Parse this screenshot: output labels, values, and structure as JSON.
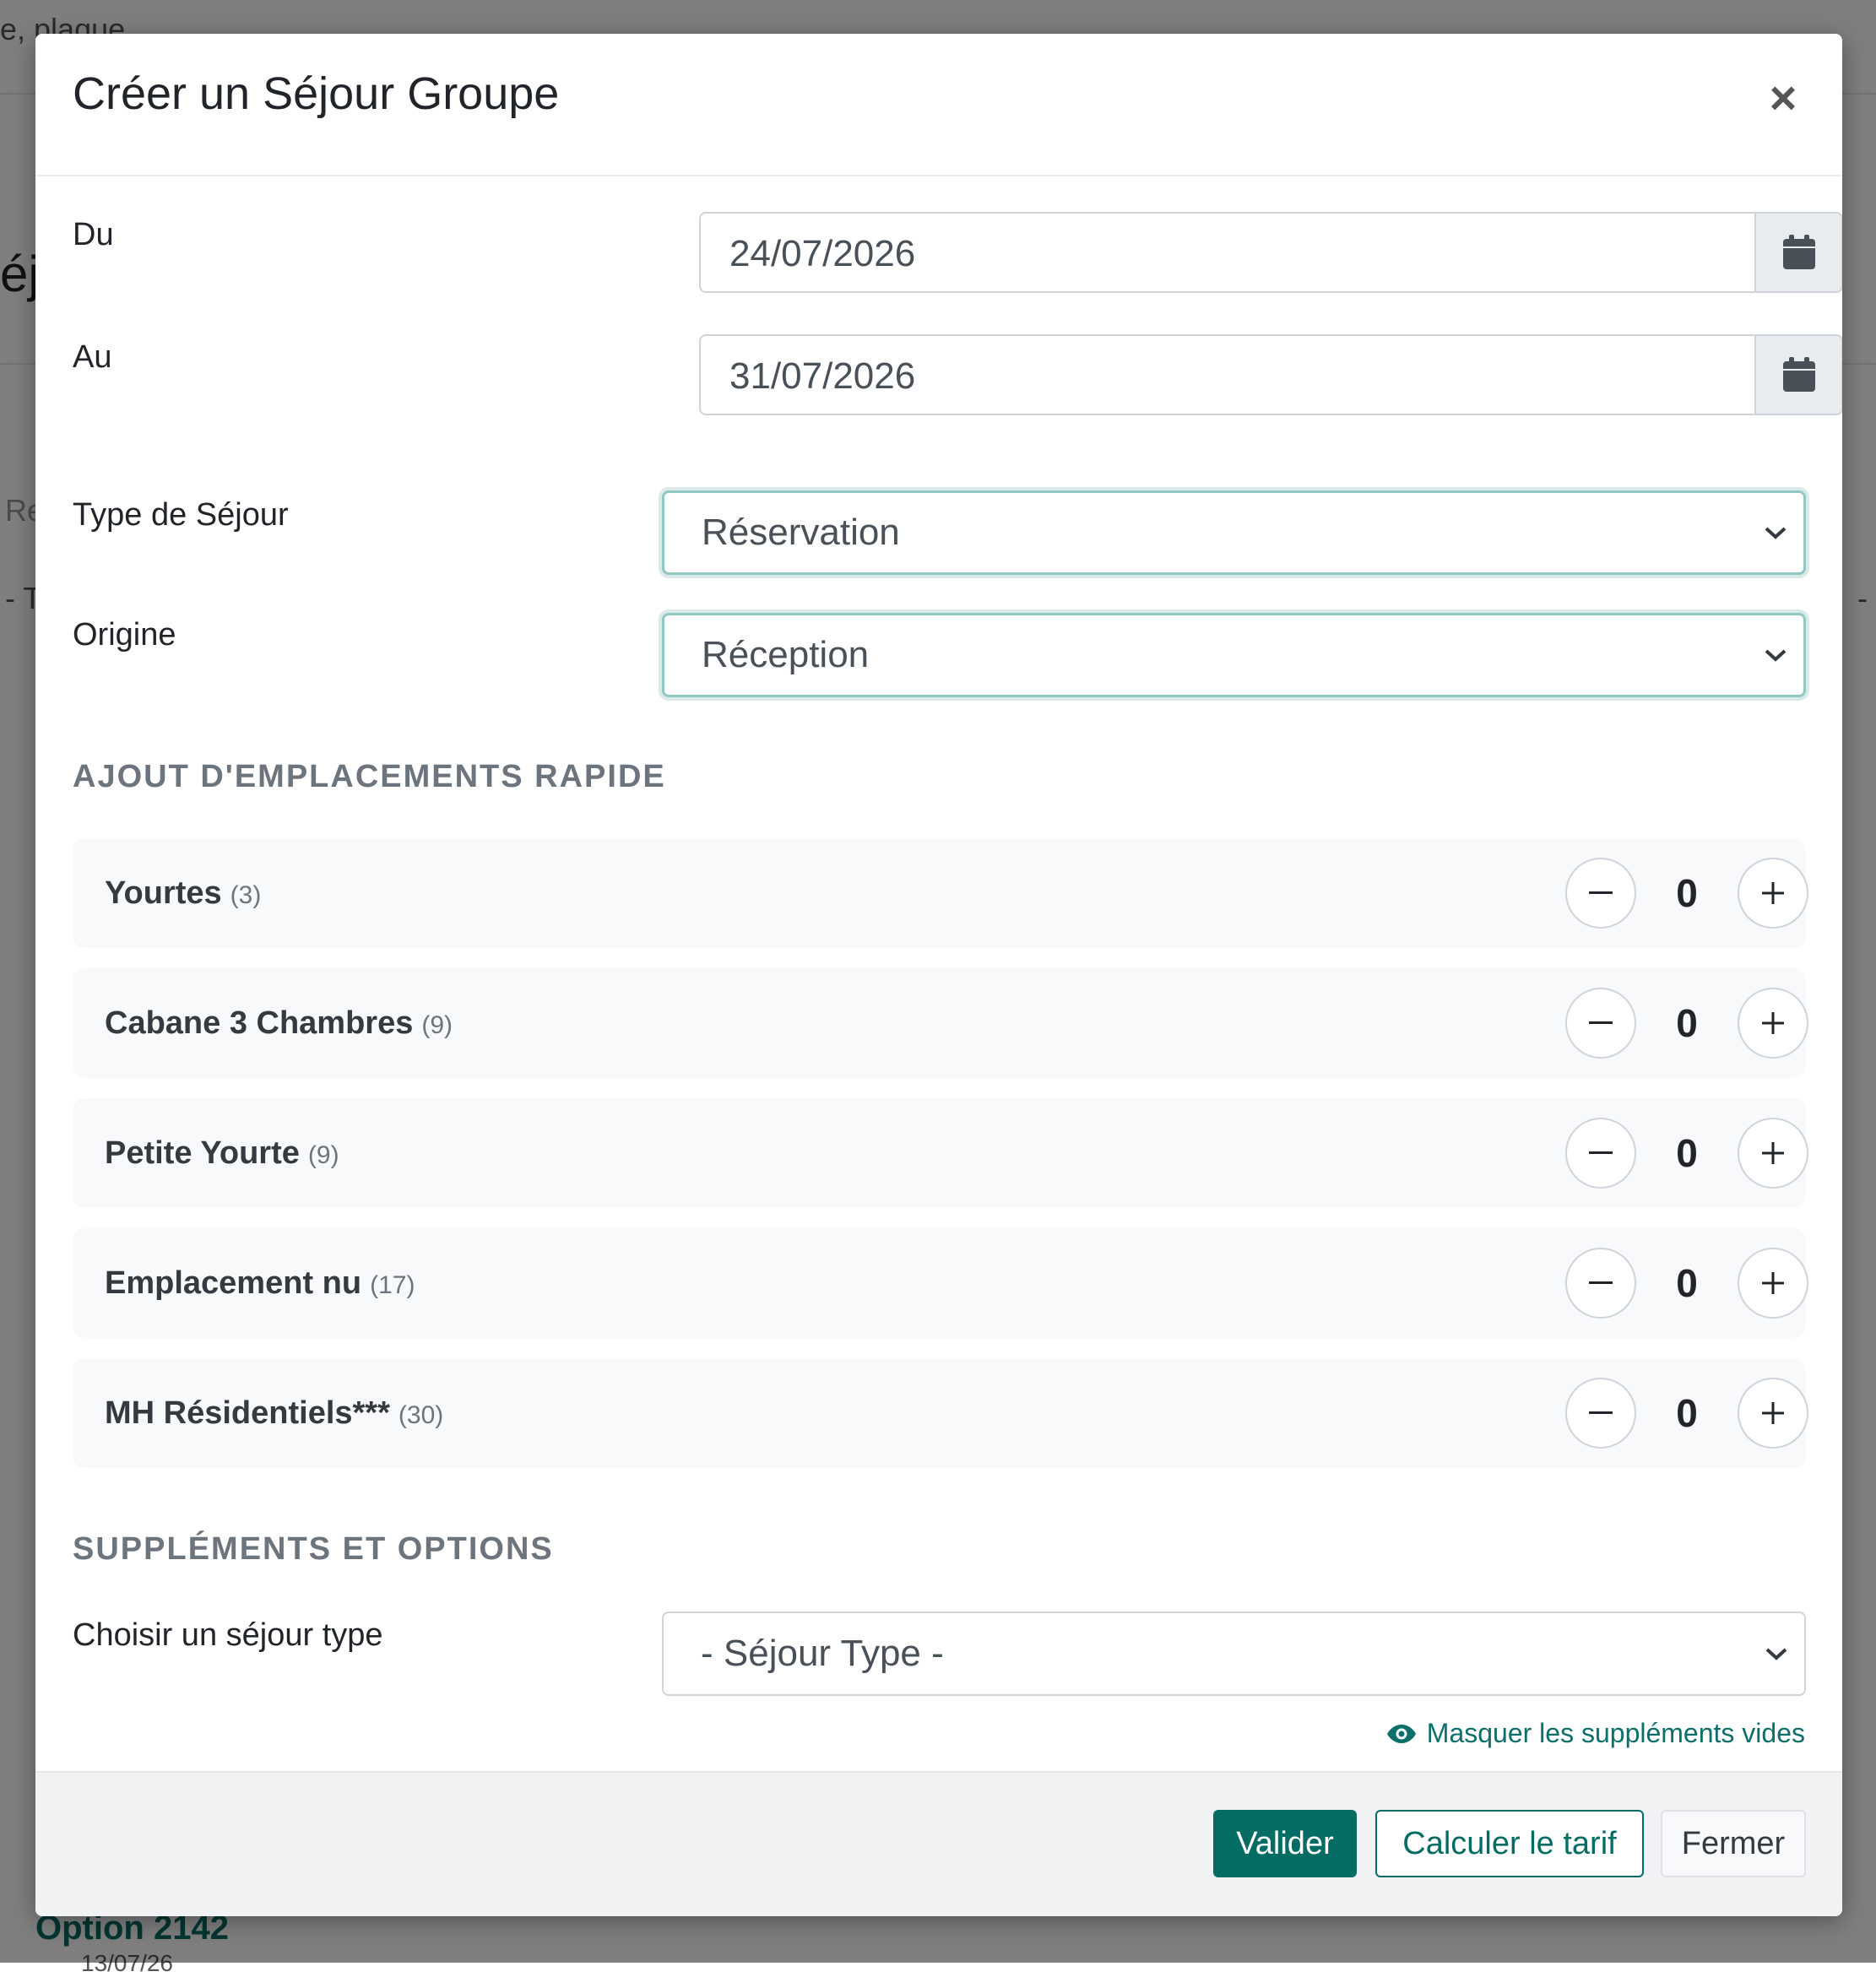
{
  "background": {
    "search_text": "e, plaque",
    "heading_fragment": "éj",
    "input_fragment": "Re",
    "dash_left": "- T",
    "dash_right": "-",
    "option_title": "Option 2142",
    "option_date": "13/07/26"
  },
  "modal": {
    "title": "Créer un Séjour Groupe",
    "close_label": "×",
    "from_label": "Du",
    "from_value": "24/07/2026",
    "to_label": "Au",
    "to_value": "31/07/2026",
    "type_label": "Type de Séjour",
    "type_value": "Réservation",
    "origin_label": "Origine",
    "origin_value": "Réception",
    "quick_add_title": "AJOUT D'EMPLACEMENTS RAPIDE",
    "accommodations": [
      {
        "name": "Yourtes",
        "count": "(3)",
        "qty": "0"
      },
      {
        "name": "Cabane 3 Chambres",
        "count": "(9)",
        "qty": "0"
      },
      {
        "name": "Petite Yourte",
        "count": "(9)",
        "qty": "0"
      },
      {
        "name": "Emplacement nu",
        "count": "(17)",
        "qty": "0"
      },
      {
        "name": "MH Résidentiels***",
        "count": "(30)",
        "qty": "0"
      }
    ],
    "supplements_title": "SUPPLÉMENTS ET OPTIONS",
    "choose_label": "Choisir un séjour type",
    "choose_value": "- Séjour Type -",
    "hide_empty_link": "Masquer les suppléments vides",
    "buttons": {
      "validate": "Valider",
      "calculate": "Calculer le tarif",
      "close": "Fermer"
    }
  },
  "colors": {
    "primary": "#046c63",
    "focus_border": "#8fc7c3",
    "section_text": "#6c757d"
  }
}
